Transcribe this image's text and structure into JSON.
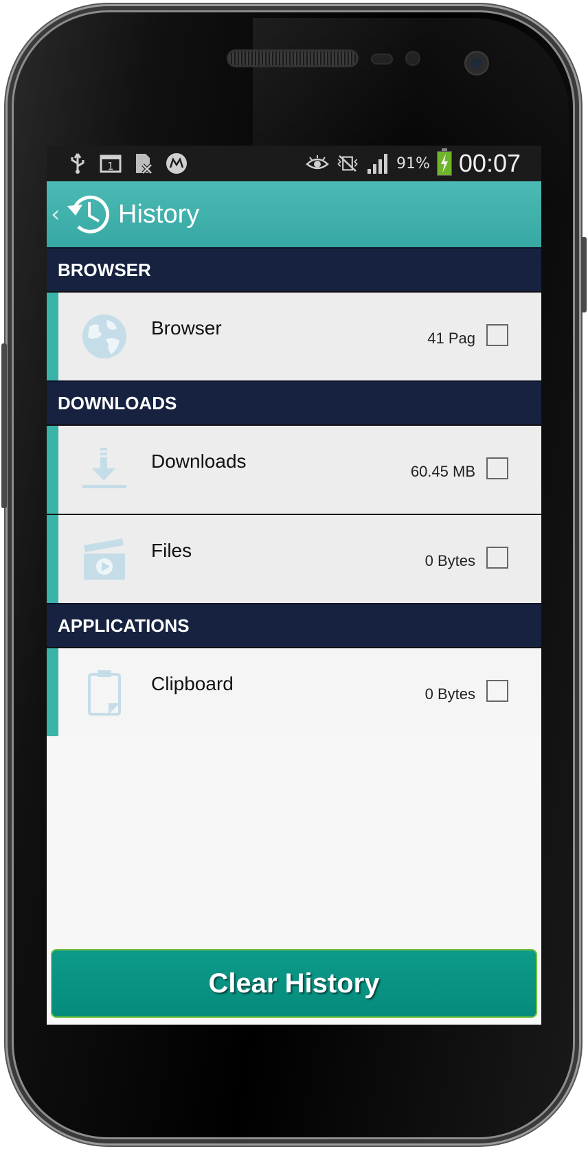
{
  "status_bar": {
    "icons_left": [
      "usb-icon",
      "calendar-icon",
      "sim-missing-icon",
      "moto-icon"
    ],
    "calendar_day": "1",
    "icons_right": [
      "eye-icon",
      "vibrate-off-icon",
      "signal-icon"
    ],
    "battery_percent": "91%",
    "battery_level": 0.91,
    "time": "00:07"
  },
  "action_bar": {
    "title": "History",
    "icon": "history-clock-icon",
    "color": "#3fb0ac"
  },
  "sections": [
    {
      "header": "BROWSER",
      "items": [
        {
          "label": "Browser",
          "size": "41 Pag",
          "icon": "globe-icon",
          "checked": false
        }
      ]
    },
    {
      "header": "DOWNLOADS",
      "items": [
        {
          "label": "Downloads",
          "size": "60.45 MB",
          "icon": "download-icon",
          "checked": false
        },
        {
          "label": "Files",
          "size": "0 Bytes",
          "icon": "clapperboard-icon",
          "checked": false
        }
      ]
    },
    {
      "header": "APPLICATIONS",
      "items": [
        {
          "label": "Clipboard",
          "size": "0 Bytes",
          "icon": "clipboard-icon",
          "checked": false
        }
      ]
    }
  ],
  "footer": {
    "clear_button_label": "Clear History",
    "button_color": "#0a9484"
  }
}
